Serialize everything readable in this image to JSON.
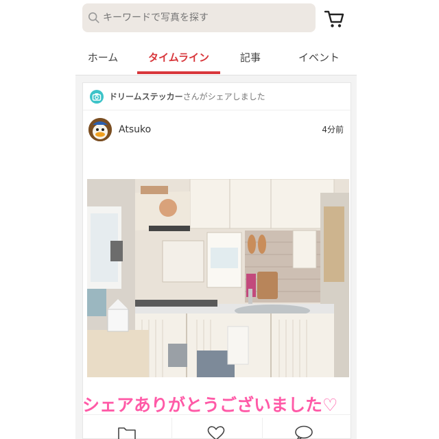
{
  "search": {
    "placeholder": "キーワードで写真を探す"
  },
  "icons": {
    "search": "search-icon",
    "cart": "cart-icon",
    "camera": "camera-icon",
    "folder": "folder-icon",
    "heart": "heart-icon",
    "comment": "comment-icon"
  },
  "tabs": [
    {
      "label": "ホーム"
    },
    {
      "label": "タイムライン",
      "active": true
    },
    {
      "label": "記事"
    },
    {
      "label": "イベント"
    }
  ],
  "colors": {
    "accent": "#d8363b",
    "caption": "#ff5aa7",
    "search_bg": "#ede8e3",
    "camera_badge": "#3cc3c8"
  },
  "post": {
    "share_name": "ドリームステッカー",
    "share_suffix": "さんがシェアしました",
    "username": "Atsuko",
    "time": "4分前"
  },
  "caption": "シェアありがとうございました♡"
}
